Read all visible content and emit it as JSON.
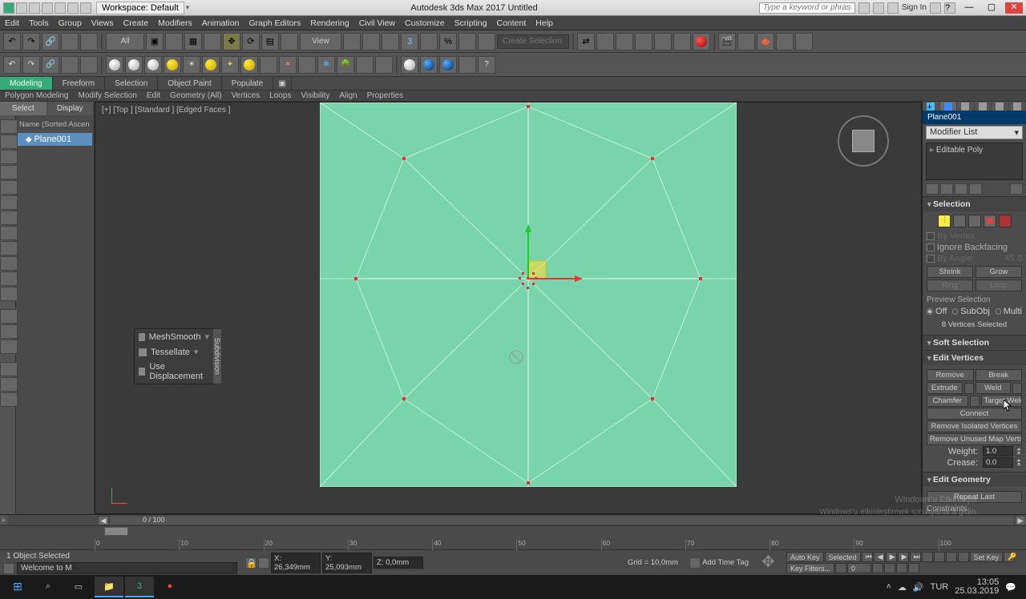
{
  "titlebar": {
    "workspace": "Workspace: Default",
    "title": "Autodesk 3ds Max 2017     Untitled",
    "search_placeholder": "Type a keyword or phrase",
    "signin": "Sign In",
    "min": "—",
    "max": "▢",
    "close": "✕"
  },
  "menu": [
    "Edit",
    "Tools",
    "Group",
    "Views",
    "Create",
    "Modifiers",
    "Animation",
    "Graph Editors",
    "Rendering",
    "Civil View",
    "Customize",
    "Scripting",
    "Content",
    "Help"
  ],
  "ribbon": {
    "view_label": "View",
    "sel_placeholder": "Create Selection Se",
    "all": "All"
  },
  "ribbon_tabs": {
    "tabs": [
      "Modeling",
      "Freeform",
      "Selection",
      "Object Paint",
      "Populate"
    ],
    "subs": [
      "Polygon Modeling",
      "Modify Selection",
      "Edit",
      "Geometry (All)",
      "Vertices",
      "Loops",
      "Visibility",
      "Align",
      "Properties"
    ]
  },
  "scene": {
    "tab_select": "Select",
    "tab_display": "Display",
    "col_header": "Name (Sorted Ascen",
    "item": "Plane001"
  },
  "viewport": {
    "label": "[+] [Top ] [Standard ] [Edged Faces ]"
  },
  "floatpanel": {
    "items": [
      "MeshSmooth",
      "Tessellate",
      "Use Displacement"
    ],
    "side": "Subdivision"
  },
  "command": {
    "obj_name": "Plane001",
    "modlist": "Modifier List",
    "stack_item": "Editable Poly",
    "rollouts": {
      "selection": "Selection",
      "soft": "Soft Selection",
      "editv": "Edit Vertices",
      "editg": "Edit Geometry"
    },
    "selection": {
      "by_vertex": "By Vertex",
      "ignore_back": "Ignore Backfacing",
      "by_angle": "By Angle:",
      "angle_val": "45.0",
      "shrink": "Shrink",
      "grow": "Grow",
      "ring": "Ring",
      "loop": "Loop",
      "preview": "Preview Selection",
      "off": "Off",
      "subobj": "SubObj",
      "multi": "Multi",
      "count": "8 Vertices Selected"
    },
    "editv": {
      "remove": "Remove",
      "break": "Break",
      "extrude": "Extrude",
      "weld": "Weld",
      "chamfer": "Chamfer",
      "target": "Target Weld",
      "connect": "Connect",
      "rem_iso": "Remove Isolated Vertices",
      "rem_map": "Remove Unused Map Verts",
      "weight": "Weight:",
      "weight_val": "1.0",
      "crease": "Crease:",
      "crease_val": "0.0"
    },
    "editg": {
      "repeat": "Repeat Last",
      "constraints": "Constraints"
    }
  },
  "watermark": {
    "l1": "Windows'u Etkinleştir",
    "l2": "Windows'u etkinleştirmek için Ayarlar'a gidin."
  },
  "track": {
    "frame": "0 / 100"
  },
  "timeline_ticks": [
    "0",
    "10",
    "20",
    "30",
    "40",
    "50",
    "60",
    "70",
    "80",
    "90",
    "100"
  ],
  "status": {
    "selected": "1 Object Selected",
    "prompt": "Welcome to M",
    "x": "X: 26,349mm",
    "y": "Y: 25,093mm",
    "z": "Z: 0,0mm",
    "grid": "Grid = 10,0mm",
    "addtag": "Add Time Tag",
    "autokey": "Auto Key",
    "selected_filter": "Selected",
    "setkey": "Set Key",
    "keyfilters": "Key Filters...",
    "frame": "0"
  },
  "taskbar": {
    "time": "13:05",
    "date": "25.03.2019"
  }
}
